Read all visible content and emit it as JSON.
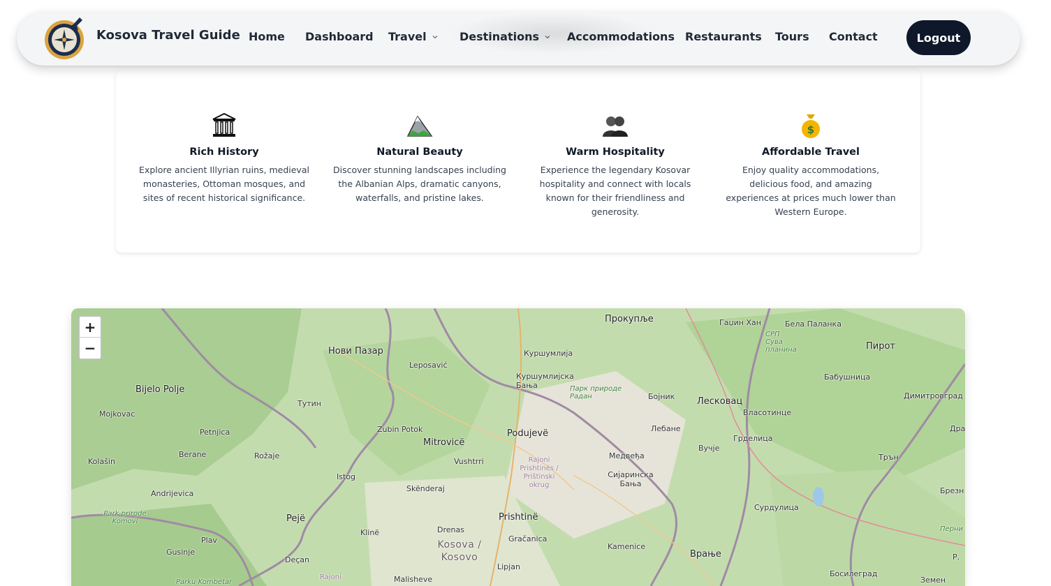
{
  "navbar": {
    "brand": "Kosova Travel Guide",
    "links": [
      {
        "label": "Home"
      },
      {
        "label": "Dashboard"
      },
      {
        "label": "Travel",
        "has_dropdown": true
      },
      {
        "label": "Destinations",
        "has_dropdown": true
      },
      {
        "label": "Accommodations"
      },
      {
        "label": "Restaurants"
      },
      {
        "label": "Tours"
      },
      {
        "label": "Contact"
      }
    ],
    "logout_label": "Logout",
    "accent_color": "#0f172a"
  },
  "features": [
    {
      "icon": "classical-building-icon",
      "title": "Rich History",
      "text": "Explore ancient Illyrian ruins, medieval monasteries, Ottoman mosques, and sites of recent historical significance."
    },
    {
      "icon": "mountain-icon",
      "title": "Natural Beauty",
      "text": "Discover stunning landscapes including the Albanian Alps, dramatic canyons, waterfalls, and pristine lakes."
    },
    {
      "icon": "people-icon",
      "title": "Warm Hospitality",
      "text": "Experience the legendary Kosovar hospitality and connect with locals known for their friendliness and generosity."
    },
    {
      "icon": "money-bag-icon",
      "title": "Affordable Travel",
      "text": "Enjoy quality accommodations, delicious food, and amazing experiences at prices much lower than Western Europe."
    }
  ],
  "map": {
    "zoom_in": "+",
    "zoom_out": "−",
    "places": [
      {
        "name": "Нови Пазар",
        "kind": "big"
      },
      {
        "name": "Прокупље",
        "kind": "big"
      },
      {
        "name": "Гаџин Хан",
        "kind": "small"
      },
      {
        "name": "Бела Паланка",
        "kind": "small"
      },
      {
        "name": "Пирот",
        "kind": "big"
      },
      {
        "name": "СРП Сува планина",
        "kind": "park"
      },
      {
        "name": "Куршумлија",
        "kind": "small"
      },
      {
        "name": "Куршумлијска Бања",
        "kind": "small"
      },
      {
        "name": "Парк природе Радан",
        "kind": "park"
      },
      {
        "name": "Бабушница",
        "kind": "small"
      },
      {
        "name": "Bijelo Polje",
        "kind": "big"
      },
      {
        "name": "Mojkovac",
        "kind": "small"
      },
      {
        "name": "Leposavić",
        "kind": "small"
      },
      {
        "name": "Тутин",
        "kind": "small"
      },
      {
        "name": "Бојник",
        "kind": "small"
      },
      {
        "name": "Лесковац",
        "kind": "big"
      },
      {
        "name": "Власотинце",
        "kind": "small"
      },
      {
        "name": "Димитровград",
        "kind": "small"
      },
      {
        "name": "Petnjica",
        "kind": "small"
      },
      {
        "name": "Zubin Potok",
        "kind": "small"
      },
      {
        "name": "Mitrovicë",
        "kind": "big"
      },
      {
        "name": "Podujevë",
        "kind": "big"
      },
      {
        "name": "Лебане",
        "kind": "small"
      },
      {
        "name": "Грделица",
        "kind": "small"
      },
      {
        "name": "Berane",
        "kind": "small"
      },
      {
        "name": "Rožaje",
        "kind": "small"
      },
      {
        "name": "Kolašin",
        "kind": "small"
      },
      {
        "name": "Vushtrri",
        "kind": "small"
      },
      {
        "name": "Rajoni Prishtinës / Prištinski okrug",
        "kind": "district"
      },
      {
        "name": "Медвеђа",
        "kind": "small"
      },
      {
        "name": "Вучје",
        "kind": "small"
      },
      {
        "name": "Трън",
        "kind": "small"
      },
      {
        "name": "Istog",
        "kind": "small"
      },
      {
        "name": "Сијаринска Бања",
        "kind": "small"
      },
      {
        "name": "Andrijevica",
        "kind": "small"
      },
      {
        "name": "Skënderaj",
        "kind": "small"
      },
      {
        "name": "Сурдулица",
        "kind": "small"
      },
      {
        "name": "Брезн",
        "kind": "small"
      },
      {
        "name": "Park prirode Komovi",
        "kind": "park"
      },
      {
        "name": "Pejë",
        "kind": "big"
      },
      {
        "name": "Prishtinë",
        "kind": "big"
      },
      {
        "name": "Drenas",
        "kind": "small"
      },
      {
        "name": "Klinë",
        "kind": "small"
      },
      {
        "name": "Gračanica",
        "kind": "small"
      },
      {
        "name": "Plav",
        "kind": "small"
      },
      {
        "name": "Kosova / Kosovo",
        "kind": "region"
      },
      {
        "name": "Kamenice",
        "kind": "small"
      },
      {
        "name": "Перни",
        "kind": "small"
      },
      {
        "name": "Gusinje",
        "kind": "small"
      },
      {
        "name": "Врање",
        "kind": "big"
      },
      {
        "name": "Deçan",
        "kind": "small"
      },
      {
        "name": "Lipjan",
        "kind": "small"
      },
      {
        "name": "Malisheve",
        "kind": "small"
      },
      {
        "name": "Босилеград",
        "kind": "small"
      },
      {
        "name": "Земен",
        "kind": "small"
      },
      {
        "name": "Parku Kombëtar",
        "kind": "park"
      },
      {
        "name": "Rajoni",
        "kind": "district"
      },
      {
        "name": "Драг",
        "kind": "small"
      },
      {
        "name": "Р.",
        "kind": "small"
      }
    ]
  }
}
